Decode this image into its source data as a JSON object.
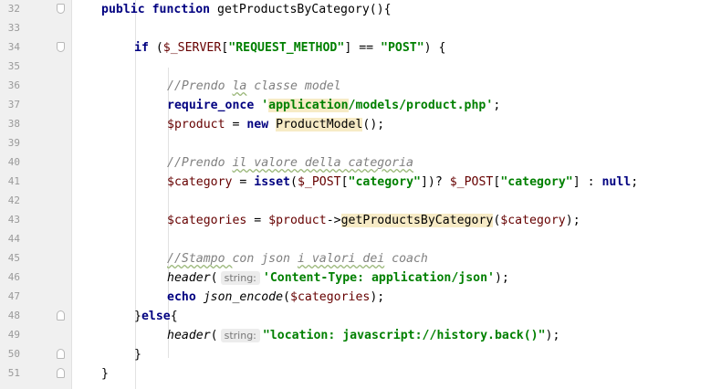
{
  "lines": [
    {
      "n": "32",
      "ind": 0,
      "fold": "open",
      "tokens": [
        {
          "t": "public function ",
          "c": "kw"
        },
        {
          "t": "getProductsByCategory(){",
          "c": "fn"
        }
      ]
    },
    {
      "n": "33",
      "ind": 0,
      "tokens": []
    },
    {
      "n": "34",
      "ind": 1,
      "fold": "open",
      "tokens": [
        {
          "t": "if ",
          "c": "kw"
        },
        {
          "t": "(",
          "c": "fn"
        },
        {
          "t": "$_SERVER",
          "c": "var"
        },
        {
          "t": "[",
          "c": "fn"
        },
        {
          "t": "\"REQUEST_METHOD\"",
          "c": "str"
        },
        {
          "t": "] == ",
          "c": "fn"
        },
        {
          "t": "\"POST\"",
          "c": "str"
        },
        {
          "t": ") {",
          "c": "fn"
        }
      ]
    },
    {
      "n": "35",
      "ind": 0,
      "tokens": []
    },
    {
      "n": "36",
      "ind": 2,
      "tokens": [
        {
          "t": "//Prendo ",
          "c": "cm"
        },
        {
          "t": "la",
          "c": "cm squig"
        },
        {
          "t": " classe ",
          "c": "cm"
        },
        {
          "t": "model",
          "c": "cm"
        }
      ]
    },
    {
      "n": "37",
      "ind": 2,
      "tokens": [
        {
          "t": "require_once ",
          "c": "kw"
        },
        {
          "t": "'",
          "c": "str"
        },
        {
          "t": "application",
          "c": "str hl"
        },
        {
          "t": "/models/product.php'",
          "c": "str"
        },
        {
          "t": ";",
          "c": "fn"
        }
      ]
    },
    {
      "n": "38",
      "ind": 2,
      "tokens": [
        {
          "t": "$product",
          "c": "var"
        },
        {
          "t": " = ",
          "c": "fn"
        },
        {
          "t": "new ",
          "c": "kw"
        },
        {
          "t": "ProductModel",
          "c": "fn hl"
        },
        {
          "t": "();",
          "c": "fn"
        }
      ]
    },
    {
      "n": "39",
      "ind": 0,
      "tokens": []
    },
    {
      "n": "40",
      "ind": 2,
      "tokens": [
        {
          "t": "//Prendo ",
          "c": "cm"
        },
        {
          "t": "il valore della categoria",
          "c": "cm squig"
        }
      ]
    },
    {
      "n": "41",
      "ind": 2,
      "tokens": [
        {
          "t": "$category",
          "c": "var"
        },
        {
          "t": " = ",
          "c": "fn"
        },
        {
          "t": "isset",
          "c": "kw"
        },
        {
          "t": "(",
          "c": "fn"
        },
        {
          "t": "$_POST",
          "c": "var"
        },
        {
          "t": "[",
          "c": "fn"
        },
        {
          "t": "\"category\"",
          "c": "str"
        },
        {
          "t": "])? ",
          "c": "fn"
        },
        {
          "t": "$_POST",
          "c": "var"
        },
        {
          "t": "[",
          "c": "fn"
        },
        {
          "t": "\"category\"",
          "c": "str"
        },
        {
          "t": "] : ",
          "c": "fn"
        },
        {
          "t": "null",
          "c": "kw"
        },
        {
          "t": ";",
          "c": "fn"
        }
      ]
    },
    {
      "n": "42",
      "ind": 0,
      "tokens": []
    },
    {
      "n": "43",
      "ind": 2,
      "tokens": [
        {
          "t": "$categories",
          "c": "var"
        },
        {
          "t": " = ",
          "c": "fn"
        },
        {
          "t": "$product",
          "c": "var"
        },
        {
          "t": "->",
          "c": "fn"
        },
        {
          "t": "getProductsByCategory",
          "c": "fn hl"
        },
        {
          "t": "(",
          "c": "fn"
        },
        {
          "t": "$category",
          "c": "var"
        },
        {
          "t": ");",
          "c": "fn"
        }
      ]
    },
    {
      "n": "44",
      "ind": 0,
      "tokens": []
    },
    {
      "n": "45",
      "ind": 2,
      "tokens": [
        {
          "t": "//Stampo ",
          "c": "cm squig"
        },
        {
          "t": "con json ",
          "c": "cm"
        },
        {
          "t": "i valori dei",
          "c": "cm squig"
        },
        {
          "t": " coach",
          "c": "cm"
        }
      ]
    },
    {
      "n": "46",
      "ind": 2,
      "tokens": [
        {
          "t": "header",
          "c": "fn it"
        },
        {
          "t": "(",
          "c": "fn"
        },
        {
          "t": "string:",
          "c": "hint"
        },
        {
          "t": "'Content-Type: application/json'",
          "c": "str"
        },
        {
          "t": ");",
          "c": "fn"
        }
      ]
    },
    {
      "n": "47",
      "ind": 2,
      "tokens": [
        {
          "t": "echo ",
          "c": "kw"
        },
        {
          "t": "json_encode",
          "c": "fn it"
        },
        {
          "t": "(",
          "c": "fn"
        },
        {
          "t": "$categories",
          "c": "var"
        },
        {
          "t": ");",
          "c": "fn"
        }
      ]
    },
    {
      "n": "48",
      "ind": 1,
      "fold": "close",
      "tokens": [
        {
          "t": "}",
          "c": "fn"
        },
        {
          "t": "else",
          "c": "kw"
        },
        {
          "t": "{",
          "c": "fn"
        }
      ]
    },
    {
      "n": "49",
      "ind": 2,
      "tokens": [
        {
          "t": "header",
          "c": "fn it"
        },
        {
          "t": "(",
          "c": "fn"
        },
        {
          "t": "string:",
          "c": "hint"
        },
        {
          "t": "\"location: javascript://history.back()\"",
          "c": "str"
        },
        {
          "t": ");",
          "c": "fn"
        }
      ]
    },
    {
      "n": "50",
      "ind": 1,
      "fold": "close",
      "tokens": [
        {
          "t": "}",
          "c": "fn"
        }
      ]
    },
    {
      "n": "51",
      "ind": 0,
      "fold": "close",
      "tokens": [
        {
          "t": "}",
          "c": "fn"
        }
      ]
    }
  ]
}
